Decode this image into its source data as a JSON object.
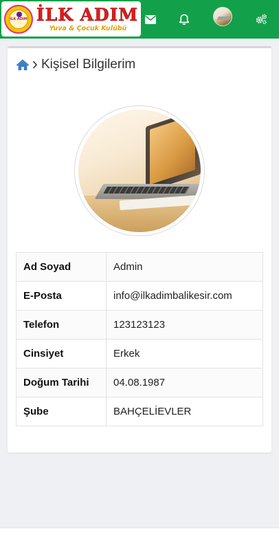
{
  "header": {
    "brand_title": "İLK ADIM",
    "brand_subtitle": "Yuva & Çocuk Kulübü",
    "emblem_text": "İLK ADIM",
    "background_color": "#12a14a",
    "icons": [
      "envelope-icon",
      "bell-icon",
      "user-avatar",
      "gears-icon"
    ]
  },
  "breadcrumb": {
    "home_icon": "home-icon",
    "separator_icon": "chevron-right-icon",
    "title": "Kişisel Bilgilerim"
  },
  "profile": {
    "rows": [
      {
        "label": "Ad Soyad",
        "value": "Admin"
      },
      {
        "label": "E-Posta",
        "value": "info@ilkadimbalikesir.com"
      },
      {
        "label": "Telefon",
        "value": "123123123"
      },
      {
        "label": "Cinsiyet",
        "value": "Erkek"
      },
      {
        "label": "Doğum Tarihi",
        "value": "04.08.1987"
      },
      {
        "label": "Şube",
        "value": "BAHÇELİEVLER"
      }
    ]
  },
  "colors": {
    "accent": "#12a14a",
    "home_icon": "#3a7fc1",
    "logo_red": "#e21b1b",
    "logo_gold": "#e0a100"
  }
}
